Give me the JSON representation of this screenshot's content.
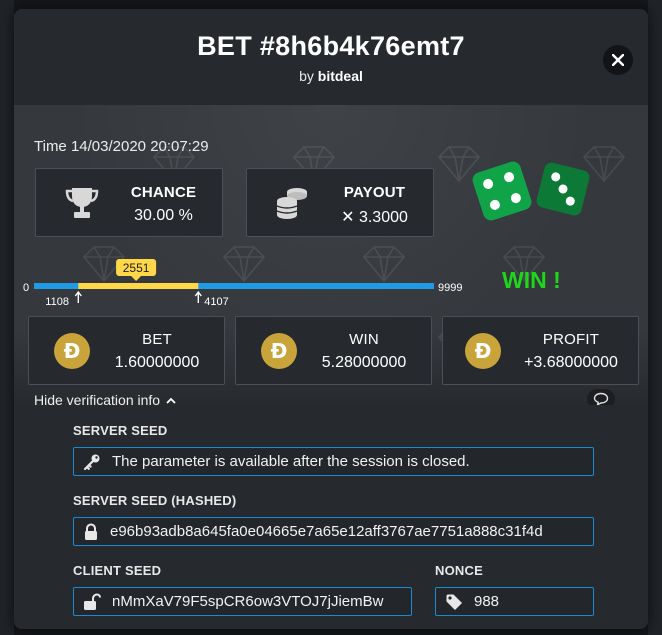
{
  "bet": {
    "title": "BET #8h6b4k76emt7",
    "by_prefix": "by",
    "by_user": "bitdeal",
    "time_label": "Time",
    "time_value": "14/03/2020 20:07:29",
    "chance": {
      "label": "CHANCE",
      "value": "30.00 %"
    },
    "payout": {
      "label": "PAYOUT",
      "value": "✕ 3.3000"
    },
    "result": "WIN !",
    "dice_faces": [
      4,
      3
    ]
  },
  "slider": {
    "min_label": "0",
    "max_label": "9999",
    "range_low": "1108",
    "range_high": "4107",
    "roll": "2551",
    "roll_value": 2551,
    "range_low_value": 1108,
    "range_high_value": 4107,
    "max_value": 9999
  },
  "amounts": [
    {
      "label": "BET",
      "value": "1.60000000",
      "icon": "dogecoin-icon"
    },
    {
      "label": "WIN",
      "value": "5.28000000",
      "icon": "dogecoin-icon"
    },
    {
      "label": "PROFIT",
      "value": "+3.68000000",
      "icon": "dogecoin-icon"
    }
  ],
  "coin_symbol": "Ð",
  "verification": {
    "toggle_label": "Hide verification info",
    "server_seed_label": "SERVER SEED",
    "server_seed_value": "The parameter is available after the session is closed.",
    "server_seed_hashed_label": "SERVER SEED (HASHED)",
    "server_seed_hashed_value": "e96b93adb8a645fa0e04665e7a65e12aff3767ae7751a888c31f4d",
    "client_seed_label": "CLIENT SEED",
    "client_seed_value": "nMmXaV79F5spCR6ow3VTOJ7jJiemBw",
    "nonce_label": "NONCE",
    "nonce_value": "988"
  },
  "colors": {
    "accent_blue": "#1e9be4",
    "accent_yellow": "#ffd84a",
    "win_green": "#1ed71b",
    "coin_gold": "#c9a43a",
    "dice_green": "#11a347",
    "dice_dark_green": "#0c7a36",
    "field_border": "#1a8bd0"
  }
}
